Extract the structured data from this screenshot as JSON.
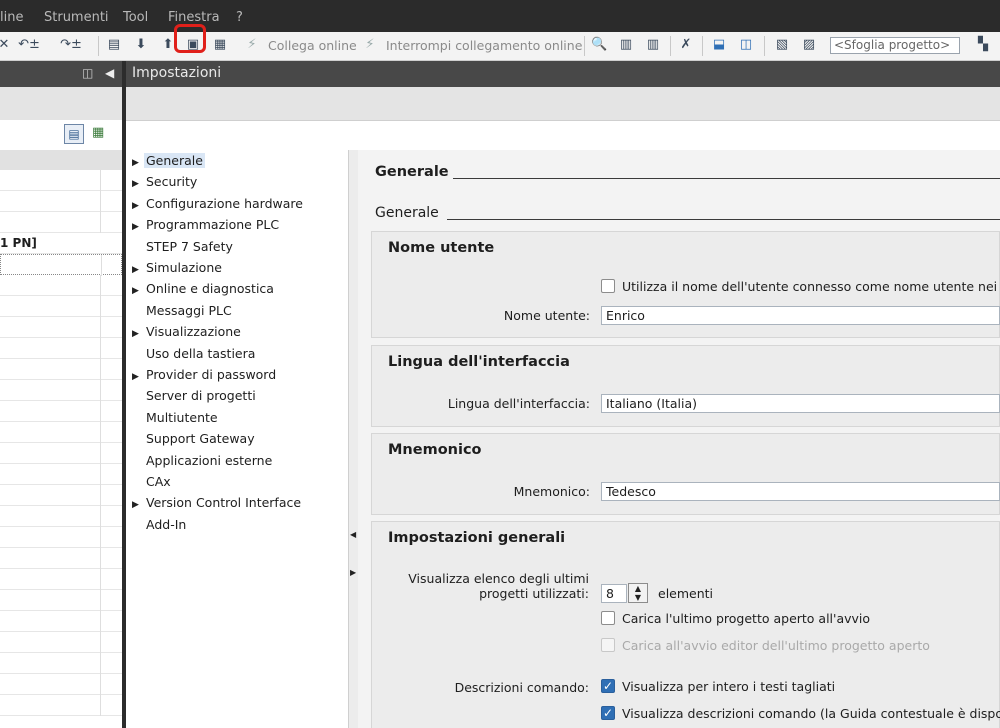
{
  "menubar": {
    "items": [
      "line",
      "Strumenti",
      "Tool",
      "Finestra",
      "?"
    ]
  },
  "toolbar": {
    "connect_online": "Collega online",
    "disconnect_online": "Interrompi collegamento online",
    "browse_project_placeholder": "<Sfoglia progetto>"
  },
  "left_pane": {
    "tree_partial_text": "1 PN]"
  },
  "settings": {
    "title": "Impostazioni",
    "nav_items": [
      {
        "label": "Generale",
        "has_children": true,
        "selected": true
      },
      {
        "label": "Security",
        "has_children": true
      },
      {
        "label": "Configurazione hardware",
        "has_children": true
      },
      {
        "label": "Programmazione PLC",
        "has_children": true
      },
      {
        "label": "STEP 7 Safety",
        "has_children": false
      },
      {
        "label": "Simulazione",
        "has_children": true
      },
      {
        "label": "Online e diagnostica",
        "has_children": true
      },
      {
        "label": "Messaggi PLC",
        "has_children": false
      },
      {
        "label": "Visualizzazione",
        "has_children": true
      },
      {
        "label": "Uso della tastiera",
        "has_children": false
      },
      {
        "label": "Provider di password",
        "has_children": true
      },
      {
        "label": "Server di progetti",
        "has_children": false
      },
      {
        "label": "Multiutente",
        "has_children": false
      },
      {
        "label": "Support Gateway",
        "has_children": false
      },
      {
        "label": "Applicazioni esterne",
        "has_children": false
      },
      {
        "label": "CAx",
        "has_children": false
      },
      {
        "label": "Version Control Interface",
        "has_children": true
      },
      {
        "label": "Add-In",
        "has_children": false
      }
    ]
  },
  "content": {
    "heading": "Generale",
    "subheading": "Generale",
    "user_name_section": {
      "title": "Nome utente",
      "use_logged_user_label": "Utilizza il nome dell'utente connesso come nome utente nei p",
      "use_logged_user_checked": false,
      "user_name_label": "Nome utente:",
      "user_name_value": "Enrico"
    },
    "language_section": {
      "title": "Lingua dell'interfaccia",
      "label": "Lingua dell'interfaccia:",
      "value": "Italiano (Italia)"
    },
    "mnemonic_section": {
      "title": "Mnemonico",
      "label": "Mnemonico:",
      "value": "Tedesco"
    },
    "general_section": {
      "title": "Impostazioni generali",
      "recent_label_line1": "Visualizza elenco degli ultimi",
      "recent_label_line2": "progetti utilizzati:",
      "recent_count": "8",
      "recent_unit": "elementi",
      "load_last_label": "Carica l'ultimo progetto aperto all'avvio",
      "load_last_checked": false,
      "load_editor_label": "Carica all'avvio editor dell'ultimo progetto aperto",
      "load_editor_enabled": false,
      "tooltips_label": "Descrizioni comando:",
      "tooltips_truncated_label": "Visualizza per intero i testi tagliati",
      "tooltips_truncated_checked": true,
      "tooltips_show_label": "Visualizza descrizioni comando (la Guida contestuale è dispon",
      "tooltips_show_checked": true
    }
  },
  "colors": {
    "menubar_bg": "#2b2b2b",
    "header_bg": "#484848",
    "accent_check": "#2f6fb5",
    "highlight_annotation": "#e0201a",
    "selection": "#d9e6f5"
  }
}
